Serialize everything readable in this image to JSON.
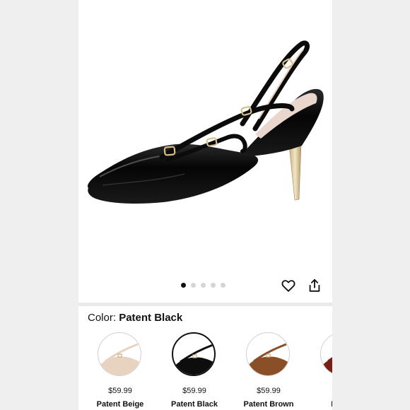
{
  "product": {
    "image_alt": "Patent Black slingback pointed-toe heel",
    "carousel": {
      "count": 5,
      "active_index": 0
    },
    "icons": {
      "favorite": "heart-icon",
      "share": "share-icon"
    }
  },
  "color_selector": {
    "label": "Color:",
    "selected": "Patent Black",
    "options": [
      {
        "name": "Patent Beige",
        "price": "$59.99",
        "tone": "#e8d2c0",
        "selected": false
      },
      {
        "name": "Patent Black",
        "price": "$59.99",
        "tone": "#0d0d0d",
        "selected": true
      },
      {
        "name": "Patent Brown",
        "price": "$59.99",
        "tone": "#8a4f26",
        "selected": false
      },
      {
        "name": "Patent",
        "price": "$",
        "tone": "#7a1e18",
        "selected": false
      }
    ]
  }
}
